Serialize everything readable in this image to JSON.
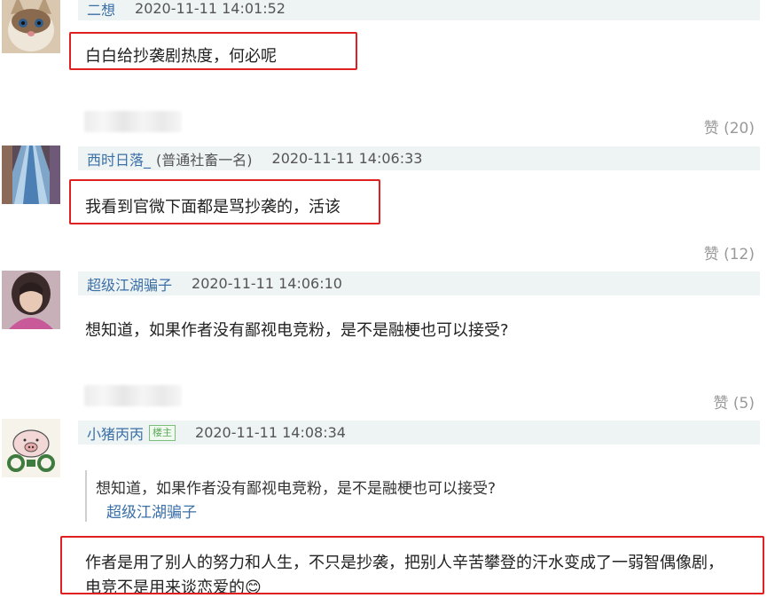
{
  "comments": [
    {
      "username": "二想",
      "timestamp": "2020-11-11 14:01:52",
      "text": "白白给抄袭剧热度，何必呢",
      "likes": "赞 (20)"
    },
    {
      "username": "西时日落_",
      "level": "(普通社畜一名)",
      "timestamp": "2020-11-11 14:06:33",
      "text": "我看到官微下面都是骂抄袭的，活该",
      "likes": "赞 (12)"
    },
    {
      "username": "超级江湖骗子",
      "timestamp": "2020-11-11 14:06:10",
      "text": "想知道，如果作者没有鄙视电竞粉，是不是融梗也可以接受?",
      "likes": "赞 (5)"
    },
    {
      "username": "小猪丙丙",
      "badge": "楼主",
      "timestamp": "2020-11-11 14:08:34",
      "quote_text": "想知道，如果作者没有鄙视电竞粉，是不是融梗也可以接受?",
      "quote_author": "超级江湖骗子",
      "text_line1": "作者是用了别人的努力和人生，不只是抄袭，把别人辛苦攀登的汗水变成了一弱智偶像剧，",
      "text_line2": "电竞不是用来谈恋爱的😊"
    }
  ],
  "colors": {
    "username": "#3a6fa8",
    "highlight_box": "#e02020",
    "header_bg": "#eef3f3",
    "likes": "#999999"
  }
}
